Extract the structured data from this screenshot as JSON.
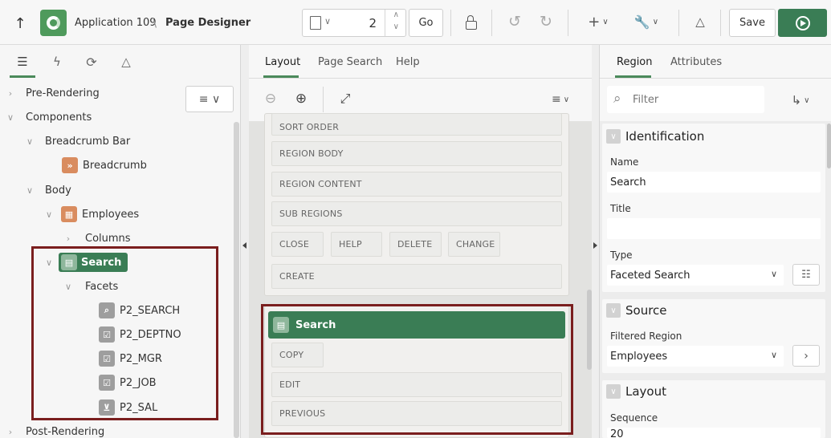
{
  "header": {
    "app_name": "Application 109",
    "separator": "\\",
    "page_title": "Page Designer",
    "page_number": "2",
    "go_label": "Go",
    "save_label": "Save"
  },
  "left": {
    "view_button_label": "≡ ∨",
    "tree": {
      "pre_rendering": "Pre-Rendering",
      "components": "Components",
      "breadcrumb_bar": "Breadcrumb Bar",
      "breadcrumb": "Breadcrumb",
      "body": "Body",
      "employees": "Employees",
      "columns": "Columns",
      "search": "Search",
      "facets": "Facets",
      "facet_items": [
        "P2_SEARCH",
        "P2_DEPTNO",
        "P2_MGR",
        "P2_JOB",
        "P2_SAL"
      ],
      "post_rendering": "Post-Rendering"
    }
  },
  "middle": {
    "tabs": [
      "Layout",
      "Page Search",
      "Help"
    ],
    "upper_slots": [
      "SORT ORDER",
      "REGION BODY",
      "REGION CONTENT",
      "SUB REGIONS"
    ],
    "button_slots": [
      "CLOSE",
      "HELP",
      "DELETE",
      "CHANGE"
    ],
    "create_slot": "CREATE",
    "search_region": "Search",
    "search_slots": [
      "COPY",
      "EDIT",
      "PREVIOUS"
    ]
  },
  "right": {
    "tabs": [
      "Region",
      "Attributes"
    ],
    "filter_placeholder": "Filter",
    "sections": {
      "identification": "Identification",
      "source": "Source",
      "layout": "Layout"
    },
    "props": {
      "name_label": "Name",
      "name_value": "Search",
      "title_label": "Title",
      "title_value": "",
      "type_label": "Type",
      "type_value": "Faceted Search",
      "filtered_region_label": "Filtered Region",
      "filtered_region_value": "Employees",
      "sequence_label": "Sequence",
      "sequence_value": "20"
    }
  },
  "colors": {
    "accent_green": "#3a7d55",
    "highlight_red": "#7a1e1e",
    "breadcrumb_orange": "#d98c5f"
  }
}
